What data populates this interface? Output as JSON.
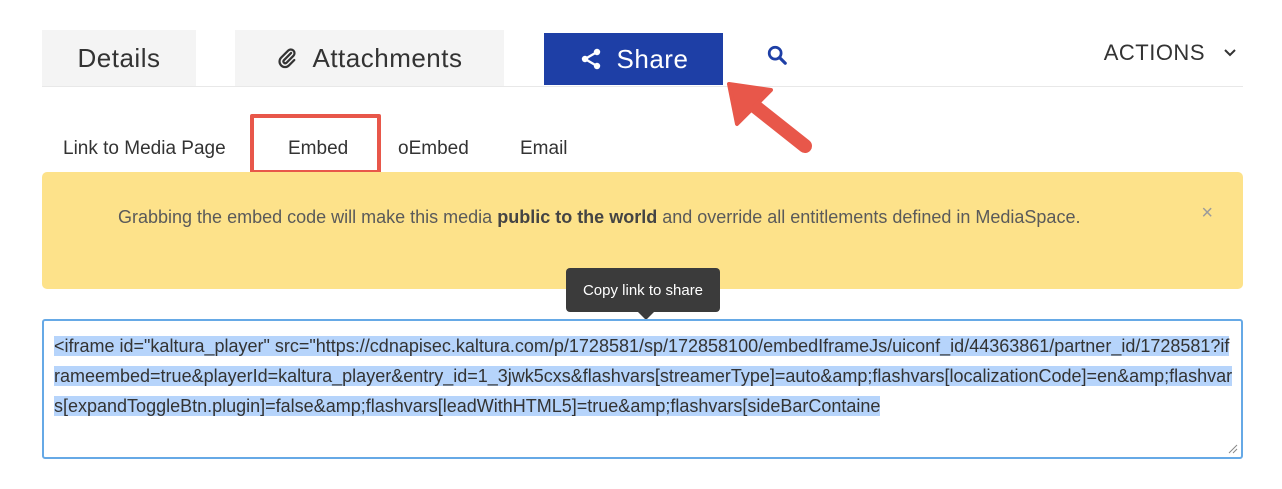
{
  "tabs": {
    "details": "Details",
    "attachments": "Attachments",
    "share": "Share",
    "actions": "ACTIONS"
  },
  "icons": {
    "attachments": "paperclip-icon",
    "share": "share-icon",
    "search": "search-icon",
    "actions": "chevron-down-icon",
    "close": "close-icon"
  },
  "share_subtabs": [
    "Link to Media Page",
    "Embed",
    "oEmbed",
    "Email"
  ],
  "alert": {
    "prefix": "Grabbing the embed code will make this media ",
    "bold": "public to the world",
    "suffix": " and override all entitlements defined in MediaSpace.",
    "close": "×"
  },
  "tooltip": "Copy link to share",
  "embed_code": "<iframe id=\"kaltura_player\" src=\"https://cdnapisec.kaltura.com/p/1728581/sp/172858100/embedIframeJs/uiconf_id/44363861/partner_id/1728581?iframeembed=true&playerId=kaltura_player&entry_id=1_3jwk5cxs&flashvars[streamerType]=auto&amp;flashvars[localizationCode]=en&amp;flashvars[expandToggleBtn.plugin]=false&amp;flashvars[leadWithHTML5]=true&amp;flashvars[sideBarContaine",
  "colors": {
    "share_tab": "#1e3fa6",
    "alert_bg": "#fde28a",
    "annotation": "#e8574a",
    "selection": "#b6d4fb"
  }
}
